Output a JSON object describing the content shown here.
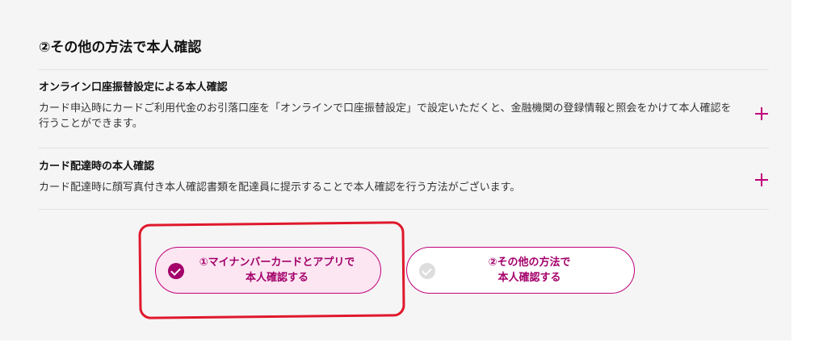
{
  "section": {
    "title": "②その他の方法で本人確認"
  },
  "accordion": [
    {
      "title": "オンライン口座振替設定による本人確認",
      "body": "カード申込時にカードご利用代金のお引落口座を「オンラインで口座振替設定」で設定いただくと、金融機関の登録情報と照会をかけて本人確認を行うことができます。",
      "toggle_icon": "plus-icon"
    },
    {
      "title": "カード配達時の本人確認",
      "body": "カード配達時に顔写真付き本人確認書類を配達員に提示することで本人確認を行う方法がございます。",
      "toggle_icon": "plus-icon"
    }
  ],
  "options": [
    {
      "line1": "①マイナンバーカードとアプリで",
      "line2": "本人確認する",
      "selected": true
    },
    {
      "line1": "②その他の方法で",
      "line2": "本人確認する",
      "selected": false
    }
  ],
  "colors": {
    "accent": "#c0007a",
    "accent_dark": "#a3006a",
    "selected_bg": "#fbe6f2",
    "annotation": "#e0182c",
    "panel_bg": "#f5f5f5"
  }
}
